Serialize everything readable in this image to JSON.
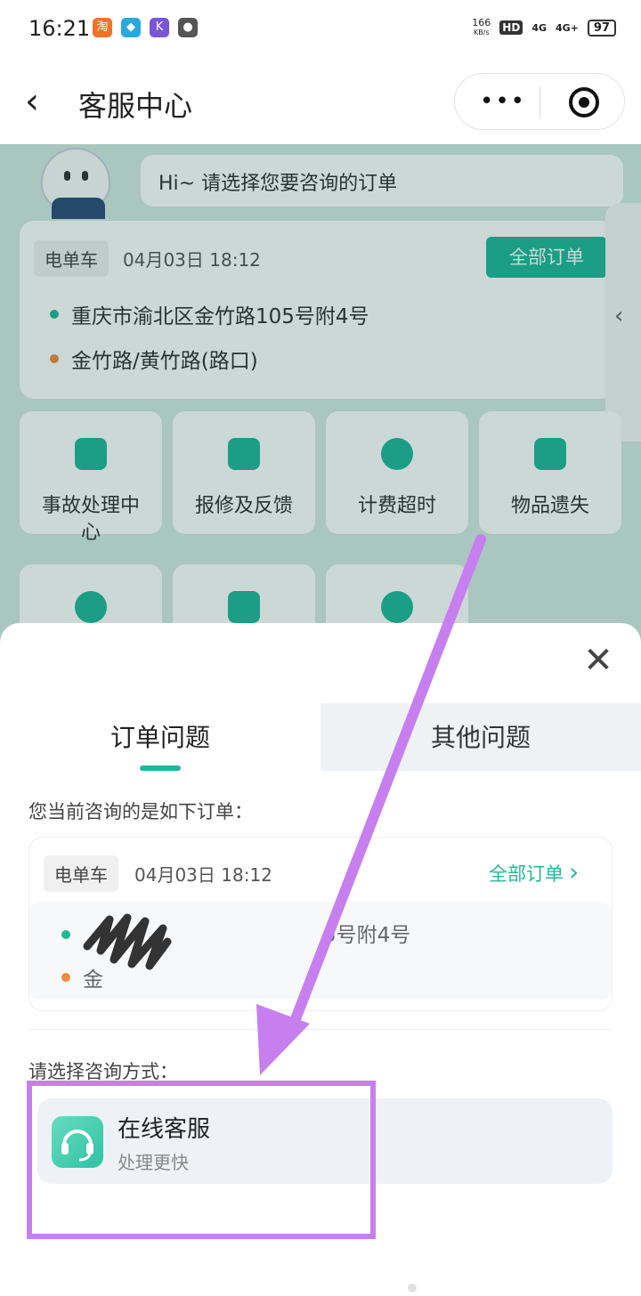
{
  "status_bar": {
    "time": "16:21",
    "speed_value": "166",
    "speed_unit": "KB/s",
    "hd_label": "HD",
    "network_1": "4G",
    "network_2": "4G+",
    "battery": "97"
  },
  "header": {
    "back_glyph": "‹",
    "title": "客服中心",
    "menu_glyph": "•••"
  },
  "background": {
    "greeting": "Hi~ 请选择您要咨询的订单",
    "order": {
      "type_tag": "电单车",
      "date": "04月03日 18:12",
      "all_orders_label": "全部订单",
      "start_address": "重庆市渝北区金竹路105号附4号",
      "end_address": "金竹路/黄竹路(路口)"
    },
    "side_tab_glyph": "‹",
    "services": [
      {
        "label": "事故处理中\n心",
        "icon": "warning-icon"
      },
      {
        "label": "报修及反馈",
        "icon": "wrench-icon"
      },
      {
        "label": "计费超时",
        "icon": "yuan-icon"
      },
      {
        "label": "物品遗失",
        "icon": "bag-icon"
      }
    ]
  },
  "sheet": {
    "close_glyph": "✕",
    "tabs": [
      {
        "label": "订单问题",
        "active": true
      },
      {
        "label": "其他问题",
        "active": false
      }
    ],
    "current_order_label": "您当前咨询的是如下订单：",
    "order": {
      "type_tag": "电单车",
      "date": "04月03日 18:12",
      "all_orders_label": "全部订单",
      "chevron_glyph": "›",
      "start_address_visible": "5号附4号",
      "end_address_visible": "金"
    },
    "method_label": "请选择咨询方式：",
    "service": {
      "title": "在线客服",
      "subtitle": "处理更快"
    }
  },
  "colors": {
    "accent": "#22b79a",
    "annotation": "#c77ff0"
  }
}
